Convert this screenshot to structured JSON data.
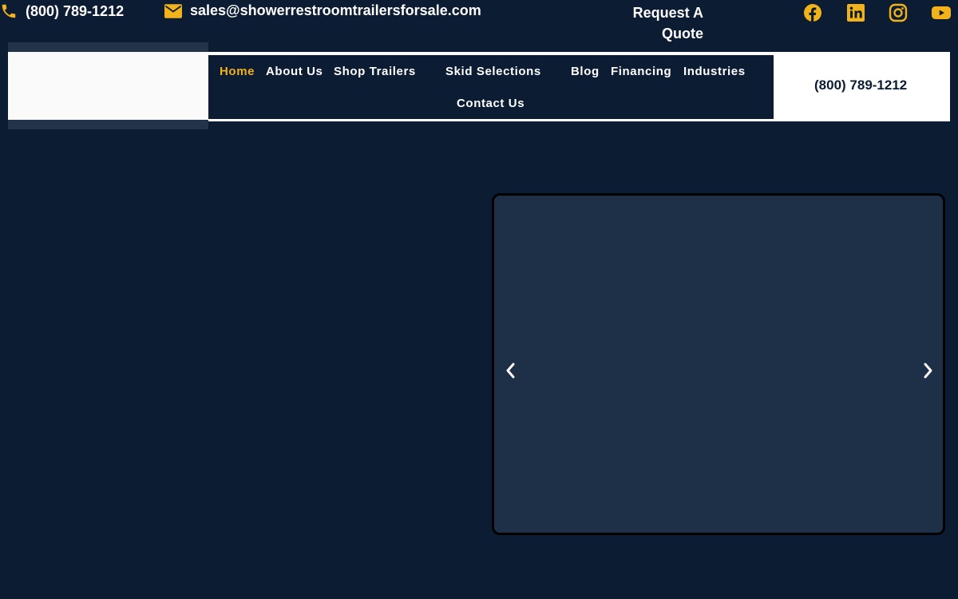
{
  "topbar": {
    "phone": "(800) 789-1212",
    "email": "sales@showerrestroomtrailersforsale.com",
    "quote_line1": "Request A",
    "quote_line2": "Quote",
    "social_icons": [
      "facebook-icon",
      "linkedin-icon",
      "instagram-icon",
      "youtube-icon"
    ]
  },
  "nav": {
    "items": [
      {
        "label": "Home",
        "active": true
      },
      {
        "label": "About Us"
      },
      {
        "label": "Shop Trailers"
      },
      {
        "label": "Skid Selections"
      },
      {
        "label": "Blog"
      },
      {
        "label": "Financing"
      },
      {
        "label": "Industries"
      },
      {
        "label": "Contact Us"
      }
    ]
  },
  "header": {
    "phone": "(800) 789-1212"
  },
  "slider": {
    "prev_icon": "chevron-left-icon",
    "next_icon": "chevron-right-icon"
  },
  "colors": {
    "background": "#0b1c33",
    "accent": "#f2b21a",
    "slider_bg": "#1d3047",
    "header_bg": "#ffffff"
  }
}
